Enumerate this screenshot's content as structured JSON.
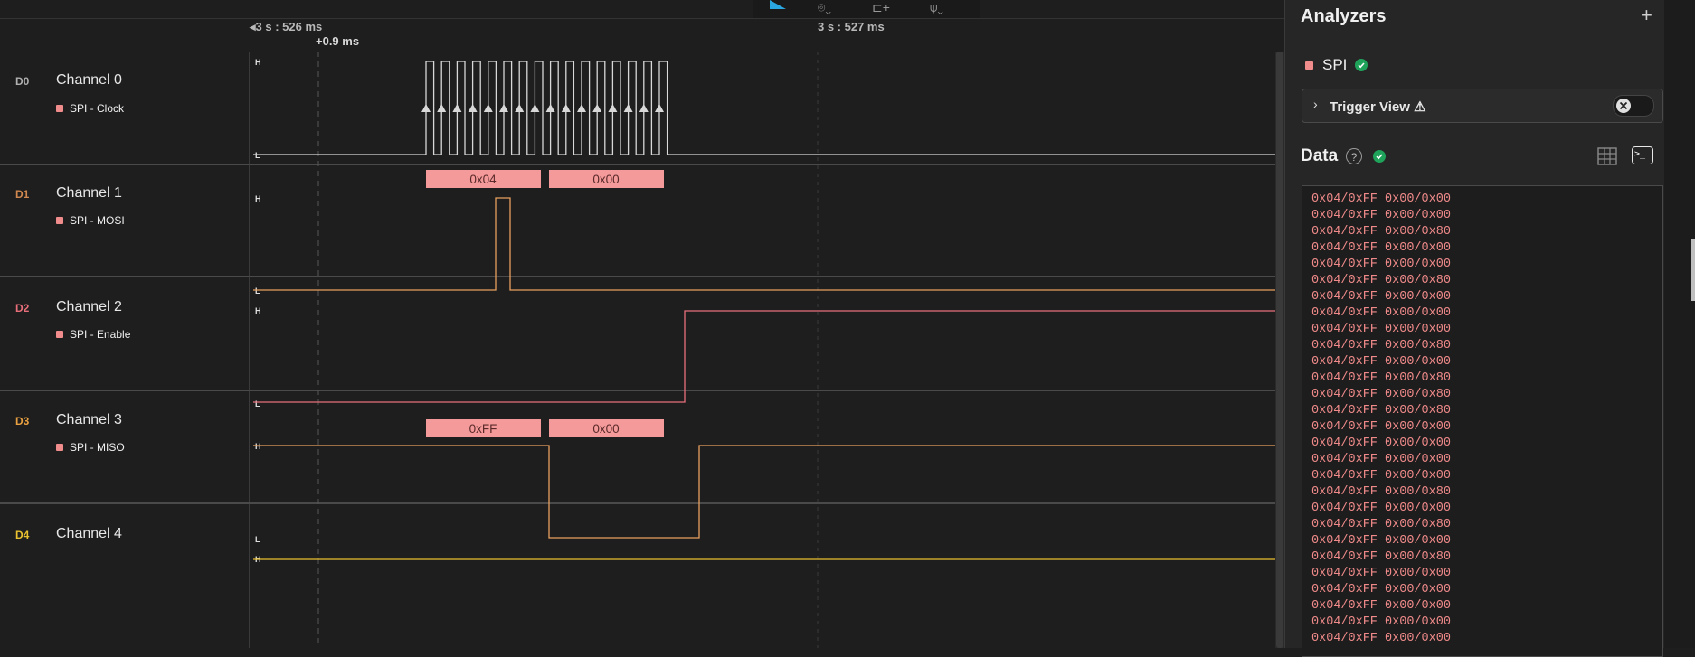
{
  "timeline": {
    "start_label": "3 s : 526 ms",
    "cursor_label": "+0.9 ms",
    "end_label": "3 s : 527 ms"
  },
  "channels": [
    {
      "id": "D0",
      "name": "Channel 0",
      "sub": "SPI - Clock",
      "color": "#c8c8c8",
      "id_color": "#b0b0b0"
    },
    {
      "id": "D1",
      "name": "Channel 1",
      "sub": "SPI - MOSI",
      "color": "#e8a060",
      "id_color": "#d08850"
    },
    {
      "id": "D2",
      "name": "Channel 2",
      "sub": "SPI - Enable",
      "color": "#e86f7a",
      "id_color": "#e86f7a"
    },
    {
      "id": "D3",
      "name": "Channel 3",
      "sub": "SPI - MISO",
      "color": "#e8a060",
      "id_color": "#e8a040"
    },
    {
      "id": "D4",
      "name": "Channel 4",
      "sub": "",
      "color": "#e8c030",
      "id_color": "#e8c030"
    }
  ],
  "level_labels": {
    "high": "H",
    "low": "L"
  },
  "decodes": {
    "mosi": [
      "0x04",
      "0x00"
    ],
    "miso": [
      "0xFF",
      "0x00"
    ]
  },
  "analyzers": {
    "title": "Analyzers",
    "add_icon": "plus-icon",
    "spi_label": "SPI",
    "trigger_view_label": "Trigger View"
  },
  "data_panel": {
    "title": "Data",
    "help_icon": "help-icon",
    "lines": [
      "0x04/0xFF 0x00/0x00",
      "0x04/0xFF 0x00/0x00",
      "0x04/0xFF 0x00/0x80",
      "0x04/0xFF 0x00/0x00",
      "0x04/0xFF 0x00/0x00",
      "0x04/0xFF 0x00/0x80",
      "0x04/0xFF 0x00/0x00",
      "0x04/0xFF 0x00/0x00",
      "0x04/0xFF 0x00/0x00",
      "0x04/0xFF 0x00/0x80",
      "0x04/0xFF 0x00/0x00",
      "0x04/0xFF 0x00/0x80",
      "0x04/0xFF 0x00/0x80",
      "0x04/0xFF 0x00/0x80",
      "0x04/0xFF 0x00/0x00",
      "0x04/0xFF 0x00/0x00",
      "0x04/0xFF 0x00/0x00",
      "0x04/0xFF 0x00/0x00",
      "0x04/0xFF 0x00/0x80",
      "0x04/0xFF 0x00/0x00",
      "0x04/0xFF 0x00/0x80",
      "0x04/0xFF 0x00/0x00",
      "0x04/0xFF 0x00/0x80",
      "0x04/0xFF 0x00/0x00",
      "0x04/0xFF 0x00/0x00",
      "0x04/0xFF 0x00/0x00",
      "0x04/0xFF 0x00/0x00",
      "0x04/0xFF 0x00/0x00"
    ]
  },
  "colors": {
    "accent": "#2aa7e0",
    "decode_fill": "#f49a9a",
    "ok_green": "#1fa35a"
  }
}
